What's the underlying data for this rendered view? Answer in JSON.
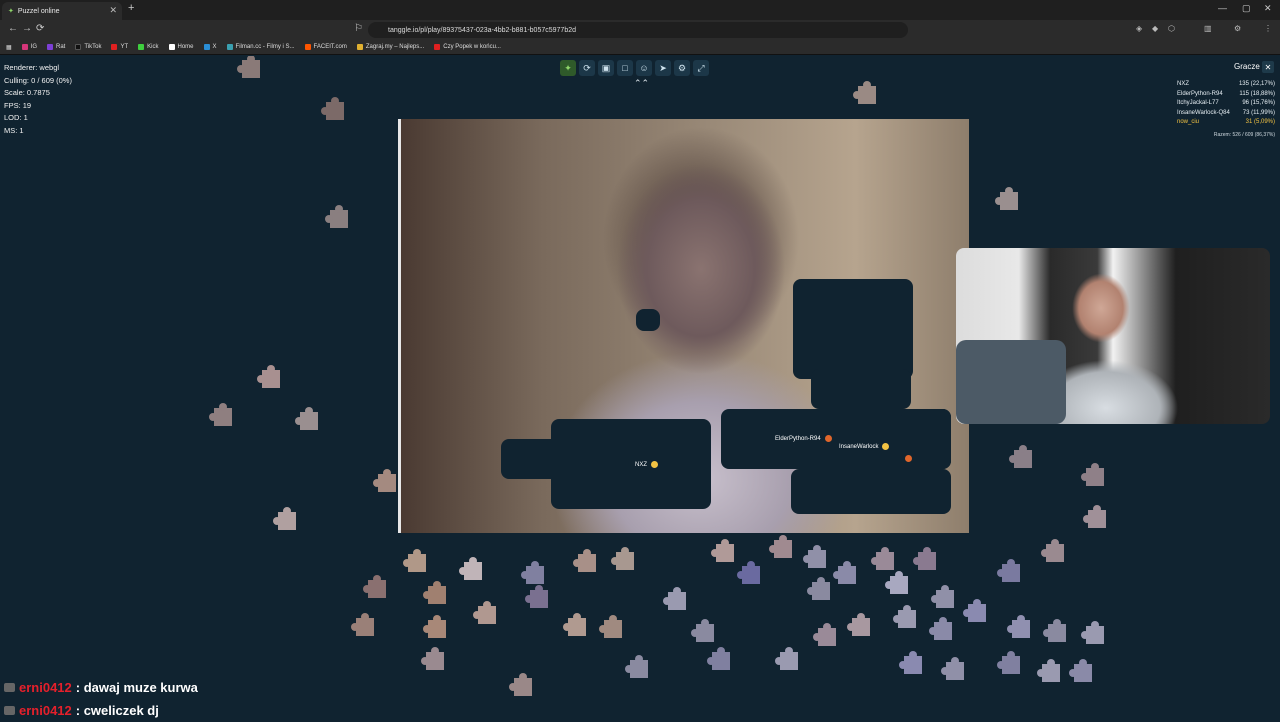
{
  "browser": {
    "tab_title": "Puzzel online",
    "url": "tanggle.io/pl/play/89375437-023a-4bb2-b881-b057c5977b2d",
    "bookmarks": [
      "IG",
      "Rat",
      "TikTok",
      "YT",
      "Kick",
      "Home",
      "X",
      "Filman.cc - Filmy i S...",
      "FACEIT.com",
      "Zagraj.my – Najleps...",
      "Czy Popek w końcu..."
    ]
  },
  "debug": {
    "renderer": "Renderer: webgl",
    "culling": "Culling: 0 / 609 (0%)",
    "scale": "Scale: 0.7875",
    "fps": "FPS: 19",
    "lod": "LOD: 1",
    "ms": "MS: 1"
  },
  "players": {
    "title": "Gracze",
    "list": [
      {
        "name": "NXZ",
        "score": "135 (22,17%)"
      },
      {
        "name": "ElderPython-R94",
        "score": "115 (18,88%)"
      },
      {
        "name": "ItchyJackal-L77",
        "score": "96 (15,76%)"
      },
      {
        "name": "InsaneWarlock-Q84",
        "score": "73 (11,99%)"
      },
      {
        "name": "now_ciu",
        "score": "31 (5,09%)"
      }
    ],
    "total": "Razem: 526 / 609 (86,37%)"
  },
  "cursors": [
    {
      "label": "NXZ",
      "color": "#f3c343"
    },
    {
      "label": "ElderPython-R94",
      "color": "#e0662b"
    },
    {
      "label": "InsaneWarlock",
      "color": "#f3c343"
    },
    {
      "label": "",
      "color": "#e0662b"
    }
  ],
  "chat": [
    {
      "user": "erni0412",
      "message": ": dawaj muze kurwa"
    },
    {
      "user": "erni0412",
      "message": ": cweliczek dj"
    }
  ],
  "icons": {
    "collapse": "⌃⌃",
    "close": "✕",
    "toolbar": [
      "⟳",
      "▣",
      "⌂",
      "□",
      "☺",
      "➤",
      "⚙",
      "⤢"
    ]
  }
}
